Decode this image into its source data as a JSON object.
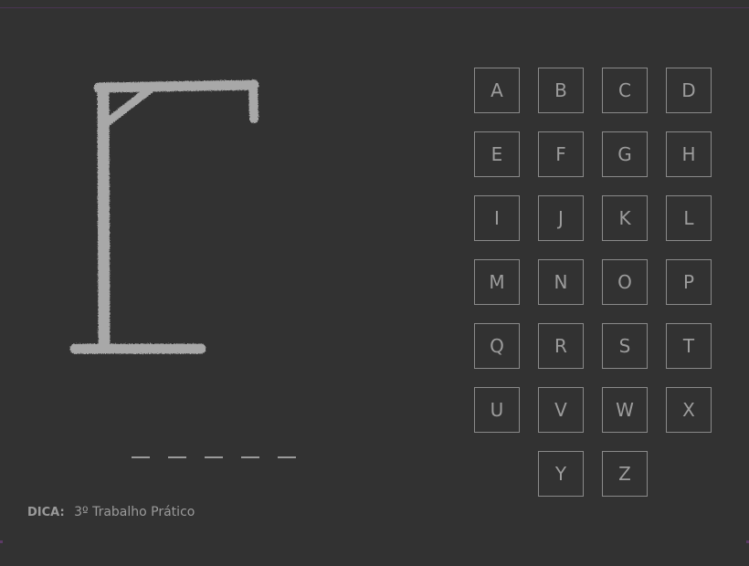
{
  "gallows": {
    "stroke_color": "#a8a8a8"
  },
  "word": {
    "slots": [
      "",
      "",
      "",
      "",
      ""
    ]
  },
  "keyboard": {
    "rows": [
      [
        "A",
        "B",
        "C",
        "D"
      ],
      [
        "E",
        "F",
        "G",
        "H"
      ],
      [
        "I",
        "J",
        "K",
        "L"
      ],
      [
        "M",
        "N",
        "O",
        "P"
      ],
      [
        "Q",
        "R",
        "S",
        "T"
      ],
      [
        "U",
        "V",
        "W",
        "X"
      ],
      [
        "",
        "Y",
        "Z",
        ""
      ]
    ],
    "key_border_color": "#8a8a8a",
    "key_text_color": "#9c9c9c"
  },
  "hint": {
    "label": "DICA:",
    "text": "3º Trabalho Prático"
  },
  "colors": {
    "background": "#323232",
    "accent_line": "#4a3553"
  }
}
